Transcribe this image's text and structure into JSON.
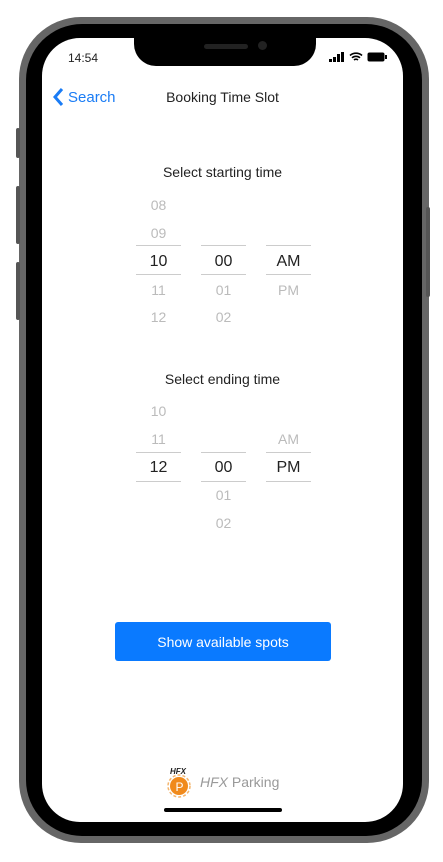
{
  "status_bar": {
    "time": "14:54"
  },
  "nav": {
    "back_label": "Search",
    "title": "Booking Time Slot"
  },
  "start": {
    "label": "Select starting time",
    "hours": [
      "08",
      "09",
      "10",
      "11",
      "12"
    ],
    "minutes": [
      "00",
      "01",
      "02"
    ],
    "periods": [
      "AM",
      "PM"
    ],
    "selected": {
      "hour": "10",
      "minute": "00",
      "period": "AM"
    }
  },
  "end": {
    "label": "Select ending time",
    "hours": [
      "10",
      "11",
      "12"
    ],
    "minutes": [
      "00",
      "01",
      "02"
    ],
    "periods": [
      "AM",
      "PM"
    ],
    "selected": {
      "hour": "12",
      "minute": "00",
      "period": "PM"
    }
  },
  "cta": {
    "label": "Show available spots"
  },
  "logo": {
    "badge_text": "HFX",
    "letter": "P",
    "name": "HFX Parking"
  },
  "colors": {
    "accent": "#0a7aff",
    "logo": "#f08a1c"
  }
}
